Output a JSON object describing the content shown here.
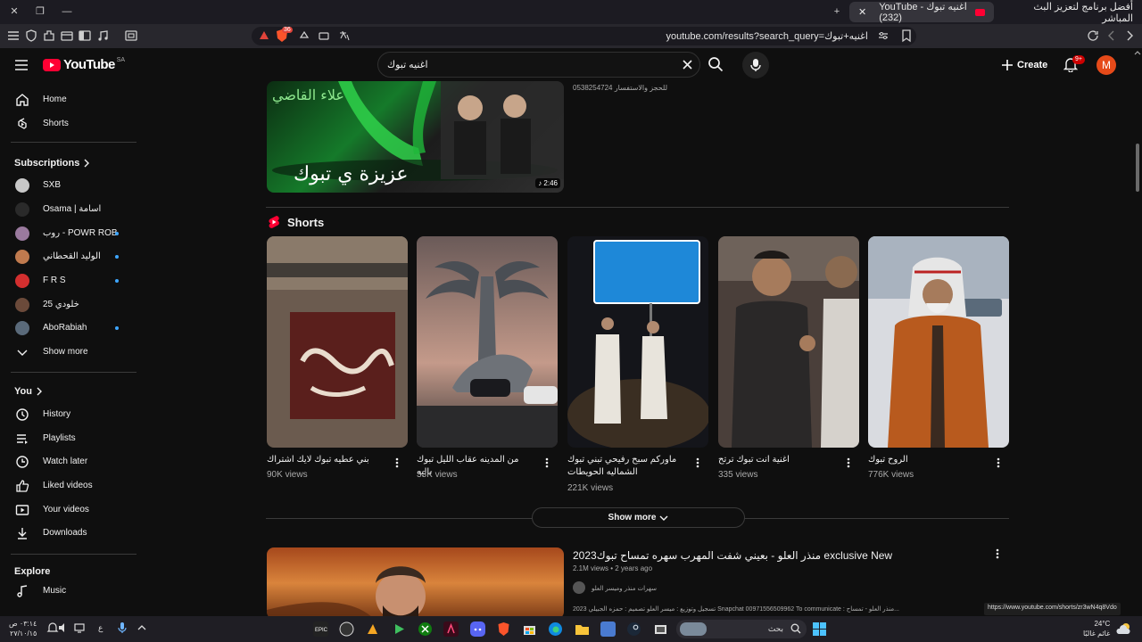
{
  "browser": {
    "tab_active": "YouTube - اغنيه تبوك (232)",
    "tab_other": "أفضل برنامج لتعزيز البث المباشر",
    "url": "youtube.com/results?search_query=اغنيه+تبوك",
    "shield_count": "36"
  },
  "masthead": {
    "logo": "YouTube",
    "region": "SA",
    "search_value": "اغنيه تبوك",
    "create_label": "Create",
    "notif_badge": "9+",
    "avatar_letter": "M"
  },
  "sidebar": {
    "main": [
      {
        "label": "Home",
        "icon": "home-icon"
      },
      {
        "label": "Shorts",
        "icon": "shorts-icon"
      }
    ],
    "subscriptions_heading": "Subscriptions",
    "subscriptions": [
      {
        "label": "SXB",
        "color": "#c8c8c8",
        "dot": false
      },
      {
        "label": "Osama | اسامة",
        "color": "#2a2a2a",
        "dot": false
      },
      {
        "label": "روب - POWR ROB",
        "color": "#9a7a9e",
        "dot": true
      },
      {
        "label": "الوليد القحطاني",
        "color": "#c07a4e",
        "dot": true
      },
      {
        "label": "F R S",
        "color": "#d32f2f",
        "dot": true
      },
      {
        "label": "25 خلودي",
        "color": "#6b4a3a",
        "dot": false
      },
      {
        "label": "AboRabiah",
        "color": "#5a6a7a",
        "dot": true
      }
    ],
    "show_more": "Show more",
    "you_heading": "You",
    "you_items": [
      {
        "label": "History",
        "icon": "history-icon"
      },
      {
        "label": "Playlists",
        "icon": "playlists-icon"
      },
      {
        "label": "Watch later",
        "icon": "watch-later-icon"
      },
      {
        "label": "Liked videos",
        "icon": "like-icon"
      },
      {
        "label": "Your videos",
        "icon": "your-videos-icon"
      },
      {
        "label": "Downloads",
        "icon": "download-icon"
      }
    ],
    "explore_heading": "Explore",
    "explore_items": [
      {
        "label": "Music",
        "icon": "music-icon"
      }
    ]
  },
  "results": {
    "video1": {
      "description": "0538254724 للحجز والاستفسار",
      "duration": "2:46",
      "thumb_text": "عزيزة ي تبوك",
      "thumb_name": "علاء القاضي"
    },
    "shorts_heading": "Shorts",
    "shorts": [
      {
        "title": "بني عطيه تبوك لايك اشتراك",
        "views": "90K views",
        "colors": [
          "#6b5b4f",
          "#5a1f1c"
        ]
      },
      {
        "title": "من المدينه عقاب الليل تبوك باليه",
        "views": "33K views",
        "colors": [
          "#5b4b47",
          "#b89080"
        ]
      },
      {
        "title": "ماوركم سبح رفيحي تبني تبوك الشماليه الحويطات",
        "views": "221K views",
        "colors": [
          "#14151a",
          "#3a2e22"
        ]
      },
      {
        "title": "اغنية انت تبوك ترتح",
        "views": "335 views",
        "colors": [
          "#4a3f3a",
          "#1e1a18"
        ]
      },
      {
        "title": "الروح تبوك",
        "views": "776K views",
        "colors": [
          "#d9dbe0",
          "#b85a1e"
        ]
      }
    ],
    "show_more": "Show more",
    "video2": {
      "title": "منذر العلو - بعيني شفت المهرب سهره تمساح تبوك2023 exclusive New",
      "meta": "2.1M views • 2 years ago",
      "channel": "سهرات منذر وميسر العلو",
      "description": "2023 تسجيل وتوزيع : ميسر العلو تصميم : حمزه الجبيلي Snapchat 00971556509962 To communicate : منذر العلو - تمساح..."
    }
  },
  "status_url": "https://www.youtube.com/shorts/zr3wN4q8Vdo",
  "taskbar": {
    "time": "٠٣:١٤ ص",
    "date": "٢٧/١٠/١٥",
    "search_label": "بحث",
    "weather_temp": "24°C",
    "weather_desc": "غائم غالبًا",
    "lang": "ع"
  }
}
